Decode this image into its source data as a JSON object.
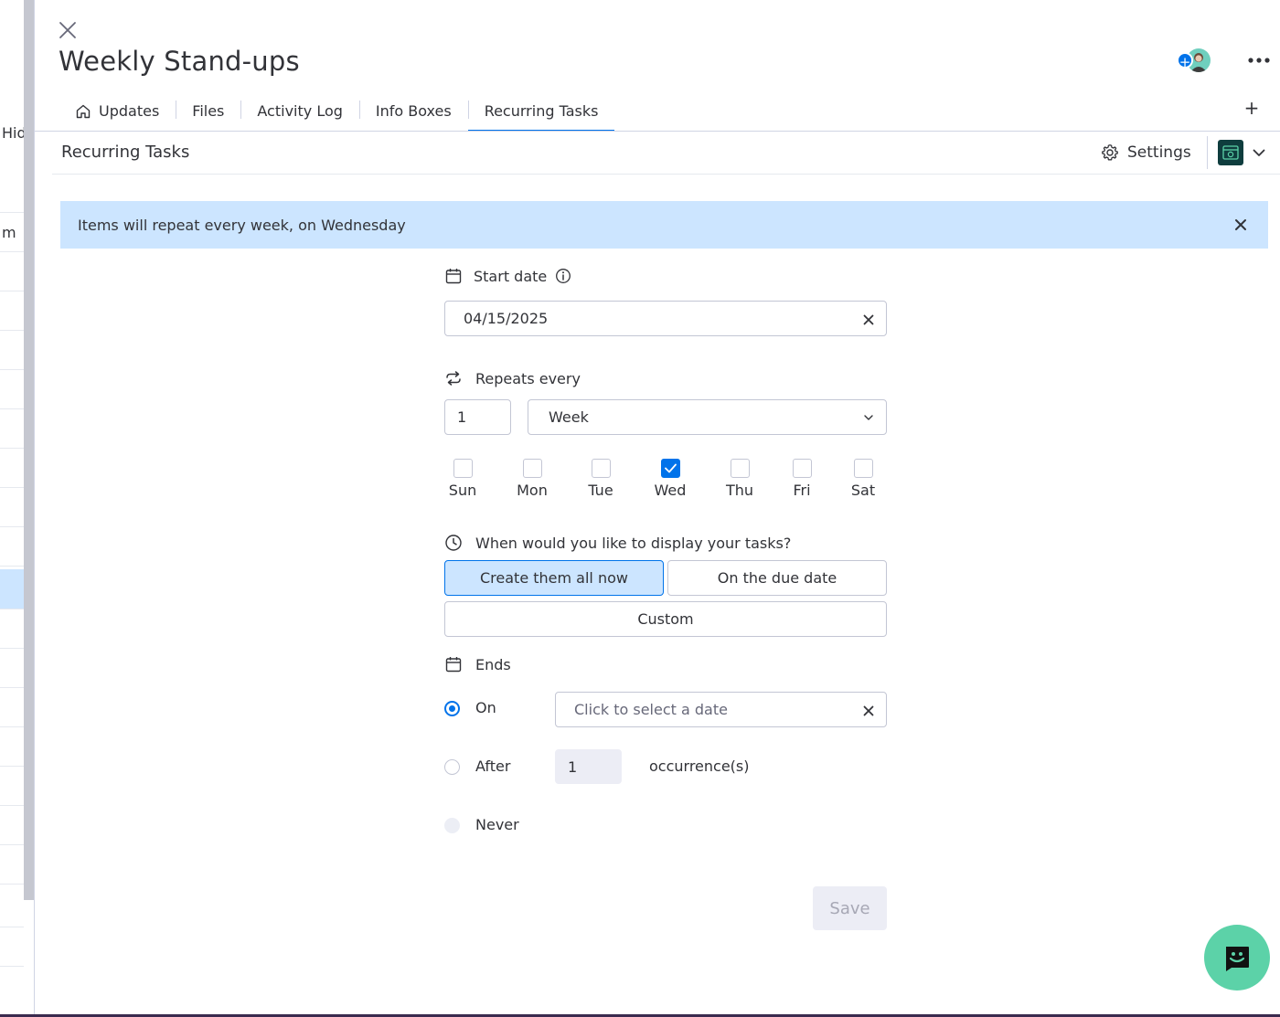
{
  "background": {
    "fragments": [
      "Hid",
      "m"
    ]
  },
  "panel": {
    "title": "Weekly Stand-ups",
    "tabs": [
      {
        "label": "Updates",
        "active": false
      },
      {
        "label": "Files",
        "active": false
      },
      {
        "label": "Activity Log",
        "active": false
      },
      {
        "label": "Info Boxes",
        "active": false
      },
      {
        "label": "Recurring Tasks",
        "active": true
      }
    ],
    "tab_add_label": "+",
    "section_title": "Recurring Tasks",
    "settings_label": "Settings"
  },
  "banner": {
    "text": "Items will repeat every week, on Wednesday"
  },
  "form": {
    "start_date": {
      "label": "Start date",
      "value": "04/15/2025"
    },
    "repeats": {
      "label": "Repeats every",
      "interval": "1",
      "unit": "Week"
    },
    "days": [
      {
        "label": "Sun",
        "checked": false
      },
      {
        "label": "Mon",
        "checked": false
      },
      {
        "label": "Tue",
        "checked": false
      },
      {
        "label": "Wed",
        "checked": true
      },
      {
        "label": "Thu",
        "checked": false
      },
      {
        "label": "Fri",
        "checked": false
      },
      {
        "label": "Sat",
        "checked": false
      }
    ],
    "display": {
      "question": "When would you like to display your tasks?",
      "options": [
        "Create them all now",
        "On the due date",
        "Custom"
      ],
      "selected": "Create them all now"
    },
    "ends": {
      "label": "Ends",
      "on_label": "On",
      "on_placeholder": "Click to select a date",
      "after_label": "After",
      "after_value": "1",
      "occurrence_label": "occurrence(s)",
      "never_label": "Never",
      "selected": "On"
    },
    "save_label": "Save"
  },
  "colors": {
    "accent": "#0073ea",
    "banner": "#cce5ff",
    "fab": "#5cd2a8"
  }
}
